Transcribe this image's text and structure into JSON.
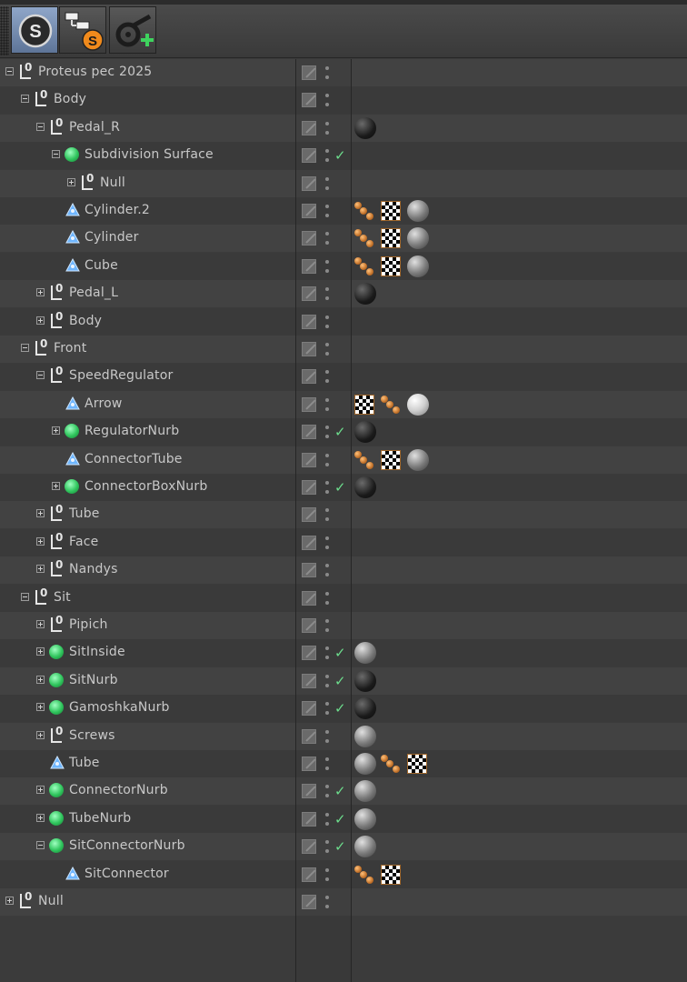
{
  "toolbar": {
    "buttons": [
      {
        "name": "scene-s-icon",
        "label": "S",
        "active": true
      },
      {
        "name": "hierarchy-s-icon",
        "label": "S",
        "active": false
      },
      {
        "name": "add-camera-icon",
        "label": "",
        "active": false
      }
    ]
  },
  "tree": {
    "rows": [
      {
        "depth": 0,
        "expander": "expanded",
        "icon": "null",
        "name": "Proteus pec 2025",
        "check": false,
        "tags": []
      },
      {
        "depth": 1,
        "expander": "expanded",
        "icon": "null",
        "name": "Body",
        "check": false,
        "tags": []
      },
      {
        "depth": 2,
        "expander": "expanded",
        "icon": "null",
        "name": "Pedal_R",
        "check": false,
        "tags": [
          "mat-dark"
        ]
      },
      {
        "depth": 3,
        "expander": "expanded",
        "icon": "generator",
        "name": "Subdivision Surface",
        "check": true,
        "tags": []
      },
      {
        "depth": 4,
        "expander": "collapsed",
        "icon": "null",
        "name": "Null",
        "check": false,
        "tags": []
      },
      {
        "depth": 3,
        "expander": "none",
        "icon": "polygon",
        "name": "Cylinder.2",
        "check": false,
        "tags": [
          "phong",
          "uvw",
          "mat-grey"
        ]
      },
      {
        "depth": 3,
        "expander": "none",
        "icon": "polygon",
        "name": "Cylinder",
        "check": false,
        "tags": [
          "phong",
          "uvw",
          "mat-grey"
        ]
      },
      {
        "depth": 3,
        "expander": "none",
        "icon": "polygon",
        "name": "Cube",
        "check": false,
        "tags": [
          "phong",
          "uvw",
          "mat-grey"
        ]
      },
      {
        "depth": 2,
        "expander": "collapsed",
        "icon": "null",
        "name": "Pedal_L",
        "check": false,
        "tags": [
          "mat-dark"
        ]
      },
      {
        "depth": 2,
        "expander": "collapsed",
        "icon": "null",
        "name": "Body",
        "check": false,
        "tags": []
      },
      {
        "depth": 1,
        "expander": "expanded",
        "icon": "null",
        "name": "Front",
        "check": false,
        "tags": []
      },
      {
        "depth": 2,
        "expander": "expanded",
        "icon": "null",
        "name": "SpeedRegulator",
        "check": false,
        "tags": []
      },
      {
        "depth": 3,
        "expander": "none",
        "icon": "polygon",
        "name": "Arrow",
        "check": false,
        "tags": [
          "uvw",
          "phong",
          "mat-white"
        ]
      },
      {
        "depth": 3,
        "expander": "collapsed",
        "icon": "generator",
        "name": "RegulatorNurb",
        "check": true,
        "tags": [
          "mat-dark"
        ]
      },
      {
        "depth": 3,
        "expander": "none",
        "icon": "polygon",
        "name": "ConnectorTube",
        "check": false,
        "tags": [
          "phong",
          "uvw",
          "mat-grey"
        ]
      },
      {
        "depth": 3,
        "expander": "collapsed",
        "icon": "generator",
        "name": "ConnectorBoxNurb",
        "check": true,
        "tags": [
          "mat-dark"
        ]
      },
      {
        "depth": 2,
        "expander": "collapsed",
        "icon": "null",
        "name": "Tube",
        "check": false,
        "tags": []
      },
      {
        "depth": 2,
        "expander": "collapsed",
        "icon": "null",
        "name": "Face",
        "check": false,
        "tags": []
      },
      {
        "depth": 2,
        "expander": "collapsed",
        "icon": "null",
        "name": "Nandys",
        "check": false,
        "tags": []
      },
      {
        "depth": 1,
        "expander": "expanded",
        "icon": "null",
        "name": "Sit",
        "check": false,
        "tags": []
      },
      {
        "depth": 2,
        "expander": "collapsed",
        "icon": "null",
        "name": "Pipich",
        "check": false,
        "tags": []
      },
      {
        "depth": 2,
        "expander": "collapsed",
        "icon": "generator",
        "name": "SitInside",
        "check": true,
        "tags": [
          "mat-grey"
        ]
      },
      {
        "depth": 2,
        "expander": "collapsed",
        "icon": "generator",
        "name": "SitNurb",
        "check": true,
        "tags": [
          "mat-dark"
        ]
      },
      {
        "depth": 2,
        "expander": "collapsed",
        "icon": "generator",
        "name": "GamoshkaNurb",
        "check": true,
        "tags": [
          "mat-dark"
        ]
      },
      {
        "depth": 2,
        "expander": "collapsed",
        "icon": "null",
        "name": "Screws",
        "check": false,
        "tags": [
          "mat-grey"
        ]
      },
      {
        "depth": 2,
        "expander": "none",
        "icon": "polygon",
        "name": "Tube",
        "check": false,
        "tags": [
          "mat-grey",
          "phong",
          "uvw"
        ]
      },
      {
        "depth": 2,
        "expander": "collapsed",
        "icon": "generator",
        "name": "ConnectorNurb",
        "check": true,
        "tags": [
          "mat-grey"
        ]
      },
      {
        "depth": 2,
        "expander": "collapsed",
        "icon": "generator",
        "name": "TubeNurb",
        "check": true,
        "tags": [
          "mat-grey"
        ]
      },
      {
        "depth": 2,
        "expander": "expanded",
        "icon": "generator",
        "name": "SitConnectorNurb",
        "check": true,
        "tags": [
          "mat-grey"
        ]
      },
      {
        "depth": 3,
        "expander": "none",
        "icon": "polygon",
        "name": "SitConnector",
        "check": false,
        "tags": [
          "phong",
          "uvw"
        ]
      },
      {
        "depth": 0,
        "expander": "collapsed",
        "icon": "null",
        "name": "Null",
        "check": false,
        "tags": []
      }
    ]
  }
}
